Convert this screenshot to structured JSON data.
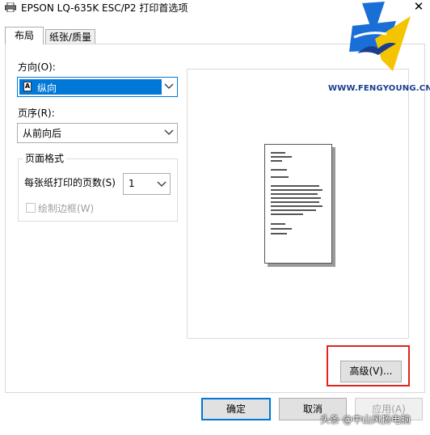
{
  "window": {
    "title": "EPSON LQ-635K ESC/P2 打印首选项",
    "close_glyph": "✕"
  },
  "tabs": [
    {
      "label": "布局",
      "active": true
    },
    {
      "label": "纸张/质量",
      "active": false
    }
  ],
  "layout": {
    "orientation_label": "方向(O):",
    "orientation_value": "纵向",
    "orientation_icon_glyph": "A",
    "page_order_label": "页序(R):",
    "page_order_value": "从前向后",
    "page_format_group_title": "页面格式",
    "pages_per_sheet_label": "每张纸打印的页数(S)",
    "pages_per_sheet_value": "1",
    "draw_borders_label": "绘制边框(W)",
    "draw_borders_checked": false,
    "draw_borders_enabled": false
  },
  "buttons": {
    "advanced": "高级(V)...",
    "ok": "确定",
    "cancel": "取消",
    "apply": "应用(A)"
  },
  "overlay": {
    "site_text": "WWW.FENGYOUNG.CN",
    "watermark": "头条 @中山风扬电脑",
    "highlight_color": "#e0251c",
    "logo_colors": [
      "#1a6fd6",
      "#f5c400",
      "#1a3d8f"
    ]
  },
  "colors": {
    "accent": "#0078d7",
    "button_face": "#e1e1e1"
  }
}
